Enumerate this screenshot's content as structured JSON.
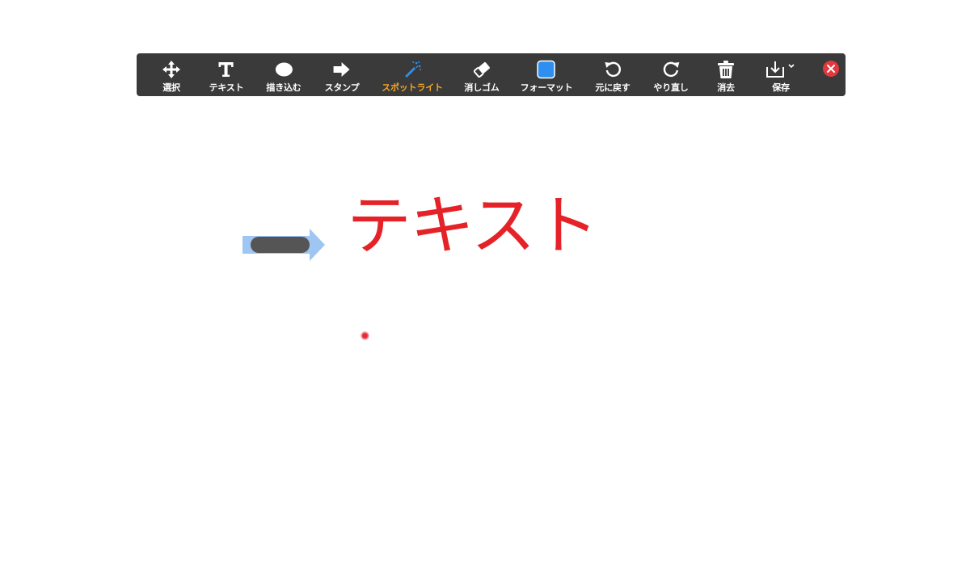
{
  "toolbar": {
    "tools": [
      {
        "id": "select",
        "label": "選択",
        "icon": "move-arrows-icon"
      },
      {
        "id": "text",
        "label": "テキスト",
        "icon": "text-t-icon"
      },
      {
        "id": "draw",
        "label": "描き込む",
        "icon": "ellipse-icon"
      },
      {
        "id": "stamp",
        "label": "スタンプ",
        "icon": "arrow-right-icon"
      },
      {
        "id": "spotlight",
        "label": "スポットライト",
        "icon": "magic-wand-icon",
        "active": true
      },
      {
        "id": "eraser",
        "label": "消しゴム",
        "icon": "eraser-icon"
      },
      {
        "id": "format",
        "label": "フォーマット",
        "icon": "color-swatch-icon"
      },
      {
        "id": "undo",
        "label": "元に戻す",
        "icon": "undo-icon"
      },
      {
        "id": "redo",
        "label": "やり直し",
        "icon": "redo-icon"
      },
      {
        "id": "clear",
        "label": "消去",
        "icon": "trash-icon"
      },
      {
        "id": "save",
        "label": "保存",
        "icon": "download-icon"
      }
    ],
    "close_icon": "close-icon"
  },
  "canvas": {
    "text": "テキスト"
  },
  "colors": {
    "toolbar_bg": "#3a3a3a",
    "active_label": "#f5a623",
    "accent_blue": "#2f8ff0",
    "close_red": "#e0393e",
    "canvas_text": "#e52227",
    "stamp_blue": "#9fc5f3",
    "stamp_gray": "#555555",
    "spotlight": "#e8283a"
  }
}
